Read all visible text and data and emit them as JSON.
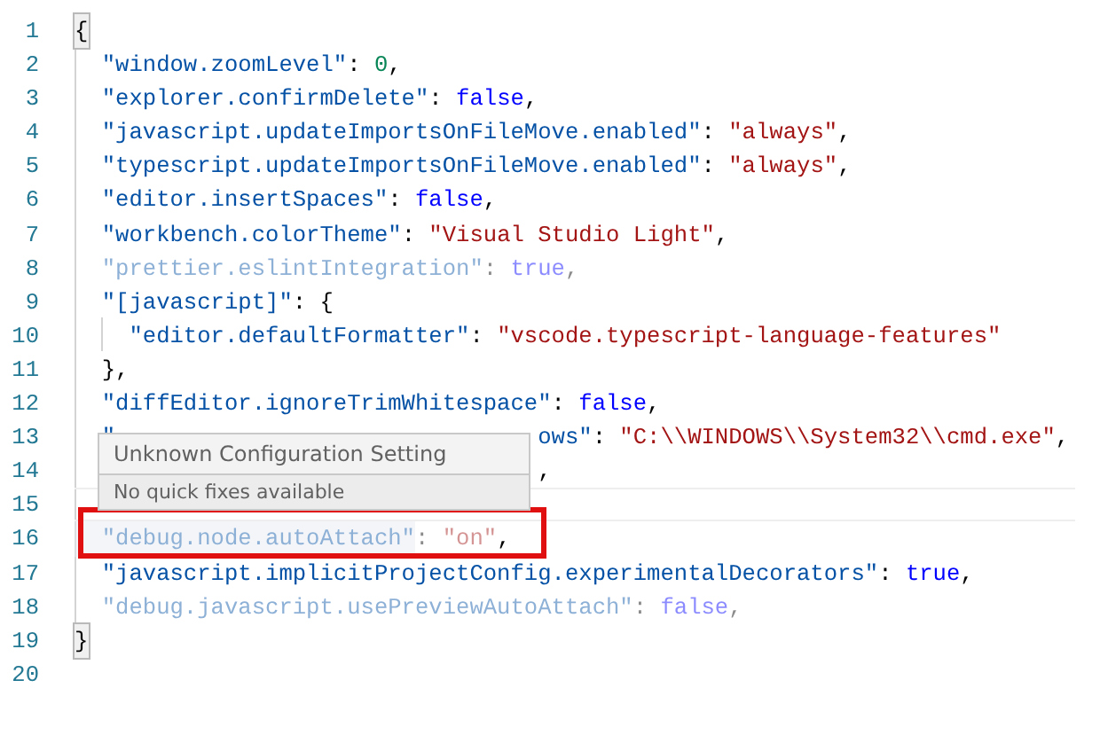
{
  "editor": {
    "lines": [
      {
        "number": "1",
        "matched_bracket": true,
        "unknown": false,
        "current": false,
        "tokens": [
          {
            "kind": "punct",
            "text": "{"
          }
        ]
      },
      {
        "number": "2",
        "matched_bracket": false,
        "unknown": false,
        "current": false,
        "tokens": [
          {
            "kind": "key",
            "text": "  \"window.zoomLevel\""
          },
          {
            "kind": "punct",
            "text": ": "
          },
          {
            "kind": "number",
            "text": "0"
          },
          {
            "kind": "punct",
            "text": ","
          }
        ]
      },
      {
        "number": "3",
        "matched_bracket": false,
        "unknown": false,
        "current": false,
        "tokens": [
          {
            "kind": "key",
            "text": "  \"explorer.confirmDelete\""
          },
          {
            "kind": "punct",
            "text": ": "
          },
          {
            "kind": "bool",
            "text": "false"
          },
          {
            "kind": "punct",
            "text": ","
          }
        ]
      },
      {
        "number": "4",
        "matched_bracket": false,
        "unknown": false,
        "current": false,
        "tokens": [
          {
            "kind": "key",
            "text": "  \"javascript.updateImportsOnFileMove.enabled\""
          },
          {
            "kind": "punct",
            "text": ": "
          },
          {
            "kind": "string",
            "text": "\"always\""
          },
          {
            "kind": "punct",
            "text": ","
          }
        ]
      },
      {
        "number": "5",
        "matched_bracket": false,
        "unknown": false,
        "current": false,
        "tokens": [
          {
            "kind": "key",
            "text": "  \"typescript.updateImportsOnFileMove.enabled\""
          },
          {
            "kind": "punct",
            "text": ": "
          },
          {
            "kind": "string",
            "text": "\"always\""
          },
          {
            "kind": "punct",
            "text": ","
          }
        ]
      },
      {
        "number": "6",
        "matched_bracket": false,
        "unknown": false,
        "current": false,
        "tokens": [
          {
            "kind": "key",
            "text": "  \"editor.insertSpaces\""
          },
          {
            "kind": "punct",
            "text": ": "
          },
          {
            "kind": "bool",
            "text": "false"
          },
          {
            "kind": "punct",
            "text": ","
          }
        ]
      },
      {
        "number": "7",
        "matched_bracket": false,
        "unknown": false,
        "current": false,
        "tokens": [
          {
            "kind": "key",
            "text": "  \"workbench.colorTheme\""
          },
          {
            "kind": "punct",
            "text": ": "
          },
          {
            "kind": "string",
            "text": "\"Visual Studio Light\""
          },
          {
            "kind": "punct",
            "text": ","
          }
        ]
      },
      {
        "number": "8",
        "matched_bracket": false,
        "unknown": true,
        "current": false,
        "tokens": [
          {
            "kind": "key",
            "text": "  \"prettier.eslintIntegration\""
          },
          {
            "kind": "punct",
            "text": ": "
          },
          {
            "kind": "bool",
            "text": "true"
          },
          {
            "kind": "punct",
            "text": ","
          }
        ]
      },
      {
        "number": "9",
        "matched_bracket": false,
        "unknown": false,
        "current": false,
        "tokens": [
          {
            "kind": "key",
            "text": "  \"[javascript]\""
          },
          {
            "kind": "punct",
            "text": ": {"
          }
        ]
      },
      {
        "number": "10",
        "matched_bracket": false,
        "unknown": false,
        "current": false,
        "tokens": [
          {
            "kind": "key",
            "text": "    \"editor.defaultFormatter\""
          },
          {
            "kind": "punct",
            "text": ": "
          },
          {
            "kind": "string",
            "text": "\"vscode.typescript-language-features\""
          }
        ]
      },
      {
        "number": "11",
        "matched_bracket": false,
        "unknown": false,
        "current": false,
        "tokens": [
          {
            "kind": "punct",
            "text": "  },"
          }
        ]
      },
      {
        "number": "12",
        "matched_bracket": false,
        "unknown": false,
        "current": false,
        "tokens": [
          {
            "kind": "key",
            "text": "  \"diffEditor.ignoreTrimWhitespace\""
          },
          {
            "kind": "punct",
            "text": ": "
          },
          {
            "kind": "bool",
            "text": "false"
          },
          {
            "kind": "punct",
            "text": ","
          }
        ]
      },
      {
        "number": "13",
        "matched_bracket": false,
        "unknown": false,
        "current": false,
        "tokens": [
          {
            "kind": "key",
            "text": "  \""
          },
          {
            "kind": "covered"
          },
          {
            "kind": "key",
            "text": "ows\""
          },
          {
            "kind": "punct",
            "text": ": "
          },
          {
            "kind": "string",
            "text": "\"C:\\\\WINDOWS\\\\System32\\\\cmd.exe\""
          },
          {
            "kind": "punct",
            "text": ","
          }
        ]
      },
      {
        "number": "14",
        "matched_bracket": false,
        "unknown": false,
        "current": false,
        "tokens": [
          {
            "kind": "covered"
          },
          {
            "kind": "punct",
            "text": ","
          }
        ]
      },
      {
        "number": "15",
        "matched_bracket": false,
        "unknown": false,
        "current": true
      },
      {
        "number": "16",
        "matched_bracket": false,
        "unknown": true,
        "current": false,
        "tokens": [
          {
            "kind": "key",
            "text": "  \"debug.node.autoAttach\"",
            "highlighted": true
          },
          {
            "kind": "punct",
            "text": ": "
          },
          {
            "kind": "string",
            "text": "\"on\""
          },
          {
            "kind": "punct",
            "text": ",",
            "plain": true
          }
        ]
      },
      {
        "number": "17",
        "matched_bracket": false,
        "unknown": false,
        "current": false,
        "tokens": [
          {
            "kind": "key",
            "text": "  \"javascript.implicitProjectConfig.experimentalDecorators\""
          },
          {
            "kind": "punct",
            "text": ": "
          },
          {
            "kind": "bool",
            "text": "true"
          },
          {
            "kind": "punct",
            "text": ","
          }
        ]
      },
      {
        "number": "18",
        "matched_bracket": false,
        "unknown": true,
        "current": false,
        "tokens": [
          {
            "kind": "key",
            "text": "  \"debug.javascript.usePreviewAutoAttach\""
          },
          {
            "kind": "punct",
            "text": ": "
          },
          {
            "kind": "bool",
            "text": "false"
          },
          {
            "kind": "punct",
            "text": ","
          }
        ]
      },
      {
        "number": "19",
        "matched_bracket": true,
        "unknown": false,
        "current": false,
        "tokens": [
          {
            "kind": "punct",
            "text": "}"
          }
        ]
      },
      {
        "number": "20",
        "matched_bracket": false,
        "unknown": false,
        "current": false
      }
    ]
  },
  "hover": {
    "title": "Unknown Configuration Setting",
    "message": "No quick fixes available"
  }
}
